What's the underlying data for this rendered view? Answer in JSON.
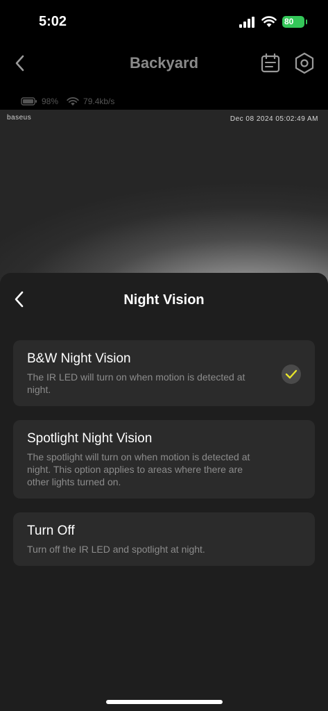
{
  "status": {
    "time": "5:02",
    "battery": "80"
  },
  "nav": {
    "title": "Backyard"
  },
  "camera": {
    "battery": "98%",
    "bitrate": "79.4kb/s",
    "brand": "baseus",
    "timestamp": "Dec 08 2024 05:02:49 AM"
  },
  "sheet": {
    "title": "Night Vision",
    "options": [
      {
        "title": "B&W Night Vision",
        "description": "The IR LED will turn on when motion is detected at night.",
        "selected": true
      },
      {
        "title": "Spotlight Night Vision",
        "description": "The spotlight will turn on when motion is detected at night. This option applies to areas where there are other lights turned on.",
        "selected": false
      },
      {
        "title": "Turn Off",
        "description": "Turn off the IR LED and spotlight at night.",
        "selected": false
      }
    ]
  },
  "colors": {
    "sheet_bg": "#1e1e1e",
    "option_bg": "#2b2b2b",
    "check_accent": "#e8e52a",
    "battery_green": "#34c759"
  },
  "icons": [
    "back-chevron-icon",
    "calendar-icon",
    "gear-icon",
    "battery-icon",
    "wifi-icon",
    "signal-icon",
    "checkmark-icon"
  ]
}
